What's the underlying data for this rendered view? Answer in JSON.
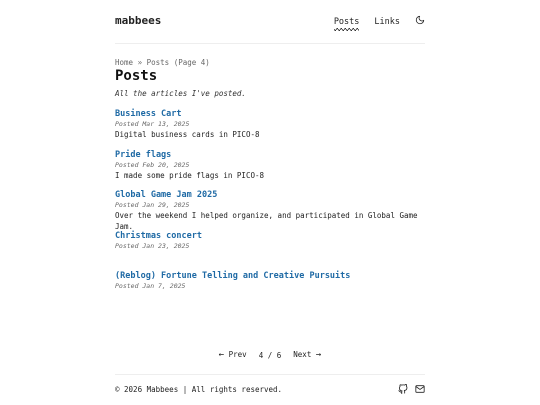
{
  "site": {
    "title": "mabbees"
  },
  "nav": {
    "items": [
      {
        "label": "Posts",
        "active": true
      },
      {
        "label": "Links",
        "active": false
      }
    ],
    "theme_toggle_icon": "moon-icon"
  },
  "breadcrumb": {
    "home": "Home",
    "separator": "»",
    "current": "Posts (Page 4)"
  },
  "page": {
    "title": "Posts",
    "subtitle": "All the articles I've posted."
  },
  "posts": [
    {
      "title": "Business Cart",
      "date": "Posted Mar 13, 2025",
      "desc": "Digital business cards in PICO-8"
    },
    {
      "title": "Pride flags",
      "date": "Posted Feb 20, 2025",
      "desc": "I made some pride flags in PICO-8"
    },
    {
      "title": "Global Game Jam 2025",
      "date": "Posted Jan 29, 2025",
      "desc": "Over the weekend I helped organize, and participated in Global Game Jam."
    },
    {
      "title": "Christmas concert",
      "date": "Posted Jan 23, 2025",
      "desc": ""
    },
    {
      "title": "(Reblog) Fortune Telling and Creative Pursuits",
      "date": "Posted Jan 7, 2025",
      "desc": ""
    }
  ],
  "pagination": {
    "prev": "Prev",
    "page": "4 / 6",
    "next": "Next"
  },
  "footer": {
    "text": "© 2026 Mabbees | All rights reserved.",
    "icons": [
      "github-icon",
      "mail-icon"
    ]
  },
  "colors": {
    "link": "#1f6aa5",
    "text": "#222222",
    "muted": "#666666"
  }
}
